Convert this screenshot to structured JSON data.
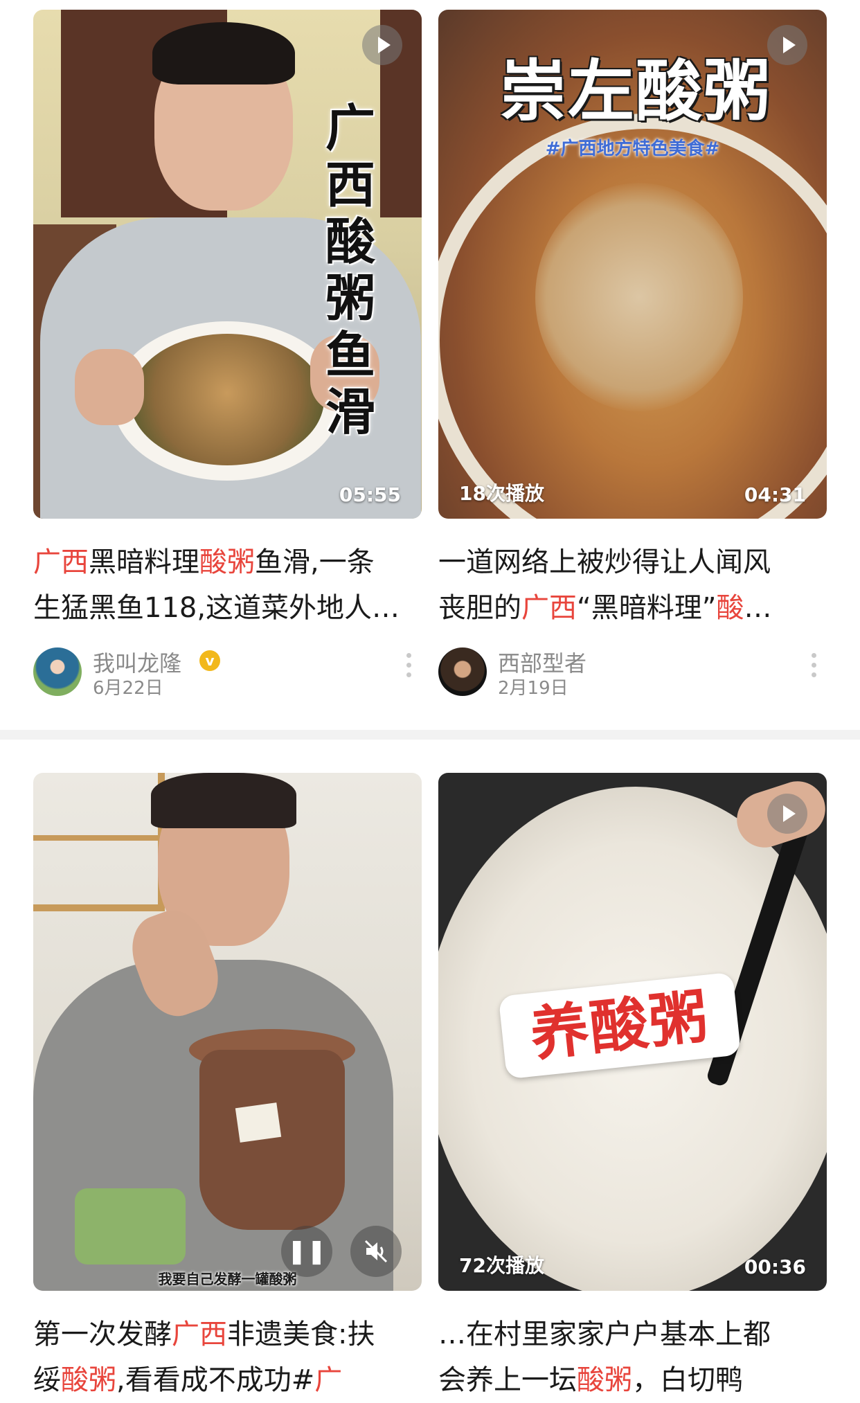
{
  "cards": [
    {
      "thumb_text": "广西酸粥鱼滑",
      "duration": "05:55",
      "title_line1": [
        {
          "t": "广西",
          "hl": true
        },
        {
          "t": "黑暗料理",
          "hl": false
        },
        {
          "t": "酸粥",
          "hl": true
        },
        {
          "t": "鱼滑,一条",
          "hl": false
        }
      ],
      "title_line2": "生猛黑鱼118,这道菜外地人…",
      "author": "我叫龙隆",
      "date": "6月22日"
    },
    {
      "thumb_title": "崇左酸粥",
      "thumb_tag": "#广西地方特色美食#",
      "plays": "18次播放",
      "duration": "04:31",
      "title_line1": "一道网络上被炒得让人闻风",
      "title_line2": [
        {
          "t": "丧胆的",
          "hl": false
        },
        {
          "t": "广西",
          "hl": true
        },
        {
          "t": "“黑暗料理”",
          "hl": false
        },
        {
          "t": "酸",
          "hl": true
        },
        {
          "t": "…",
          "hl": false
        }
      ],
      "author": "西部型者",
      "date": "2月19日"
    },
    {
      "caption": "我要自己发酵一罐酸粥",
      "title_line1": [
        {
          "t": "第一次发酵",
          "hl": false
        },
        {
          "t": "广西",
          "hl": true
        },
        {
          "t": "非遗美食:扶",
          "hl": false
        }
      ],
      "title_line2": [
        {
          "t": "绥",
          "hl": false
        },
        {
          "t": "酸粥",
          "hl": true
        },
        {
          "t": ",看看成不成功#",
          "hl": false
        },
        {
          "t": "广",
          "hl": true
        }
      ]
    },
    {
      "thumb_badge": "养酸粥",
      "plays": "72次播放",
      "duration": "00:36",
      "title_line1": "…在村里家家户户基本上都",
      "title_line2": [
        {
          "t": "会养上一坛",
          "hl": false
        },
        {
          "t": "酸粥",
          "hl": true
        },
        {
          "t": "，白切鸭",
          "hl": false
        }
      ]
    }
  ],
  "colors": {
    "highlight": "#e8453c",
    "text": "#1a1a1a",
    "meta": "#8a8a8a",
    "verified": "#f2b81b"
  },
  "icons": [
    "play-icon",
    "pause-icon",
    "mute-icon",
    "verified-icon",
    "more-icon"
  ]
}
